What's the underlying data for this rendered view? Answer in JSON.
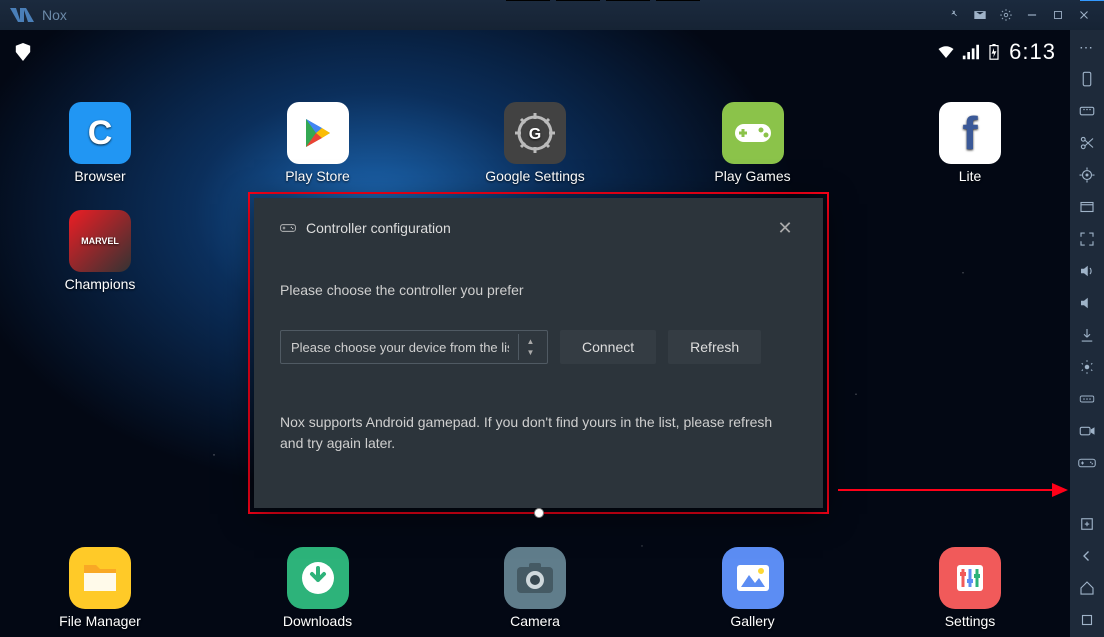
{
  "titlebar": {
    "app_name": "Nox"
  },
  "statusbar": {
    "time": "6:13"
  },
  "apps_row1": [
    {
      "key": "browser",
      "label": "Browser",
      "icon": "C",
      "cls": "browser"
    },
    {
      "key": "play-store",
      "label": "Play Store",
      "icon": "",
      "cls": "play"
    },
    {
      "key": "google-settings",
      "label": "Google Settings",
      "icon": "G",
      "cls": "settings-g"
    },
    {
      "key": "play-games",
      "label": "Play Games",
      "icon": "",
      "cls": "games"
    },
    {
      "key": "fb-lite",
      "label": "Lite",
      "icon": "f",
      "cls": "fb"
    }
  ],
  "apps_row2": [
    {
      "key": "champions",
      "label": "Champions",
      "icon": "",
      "cls": "marvel"
    }
  ],
  "dock": [
    {
      "key": "file-manager",
      "label": "File Manager",
      "cls": "fileman"
    },
    {
      "key": "downloads",
      "label": "Downloads",
      "cls": "downloads"
    },
    {
      "key": "camera",
      "label": "Camera",
      "cls": "camera"
    },
    {
      "key": "gallery",
      "label": "Gallery",
      "cls": "gallery"
    },
    {
      "key": "settings",
      "label": "Settings",
      "cls": "sys-settings"
    }
  ],
  "modal": {
    "title": "Controller configuration",
    "instruction": "Please choose the controller you prefer",
    "dropdown_placeholder": "Please choose your device from the list",
    "connect_label": "Connect",
    "refresh_label": "Refresh",
    "note": "Nox supports Android gamepad. If you don't find yours in the list, please refresh and try again later."
  },
  "sidebar_tools": [
    "more-icon",
    "rotate-icon",
    "keyboard-icon",
    "scissors-icon",
    "location-icon",
    "windowed-icon",
    "fullscreen-icon",
    "volume-up-icon",
    "volume-down-icon",
    "apk-icon",
    "shake-icon",
    "controller-mapping-icon",
    "recorder-icon",
    "gamepad-icon"
  ],
  "sidebar_bottom": [
    "add-icon",
    "back-icon",
    "home-icon",
    "recent-icon"
  ]
}
